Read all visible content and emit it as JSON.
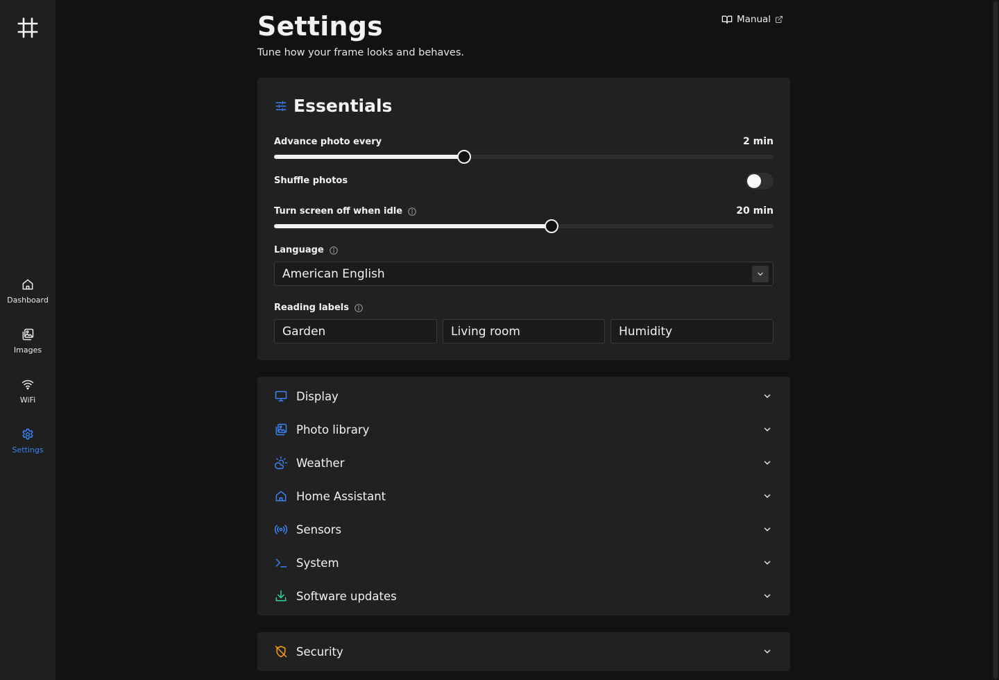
{
  "nav": {
    "items": [
      {
        "id": "dashboard",
        "label": "Dashboard",
        "icon": "home-icon",
        "active": false
      },
      {
        "id": "images",
        "label": "Images",
        "icon": "images-icon",
        "active": false
      },
      {
        "id": "wifi",
        "label": "WiFi",
        "icon": "wifi-icon",
        "active": false
      },
      {
        "id": "settings",
        "label": "Settings",
        "icon": "gear-icon",
        "active": true
      }
    ]
  },
  "header": {
    "title": "Settings",
    "subtitle": "Tune how your frame looks and behaves.",
    "manual_label": "Manual"
  },
  "essentials": {
    "title": "Essentials",
    "advance": {
      "label": "Advance photo every",
      "value": "2 min",
      "fraction": 0.38
    },
    "shuffle": {
      "label": "Shuffle photos",
      "enabled": false
    },
    "idle": {
      "label": "Turn screen off when idle",
      "value": "20 min",
      "fraction": 0.555
    },
    "language": {
      "label": "Language",
      "value": "American English"
    },
    "reading_labels": {
      "label": "Reading labels",
      "values": [
        "Garden",
        "Living room",
        "Humidity"
      ]
    }
  },
  "sections": [
    {
      "label": "Display",
      "icon": "monitor-icon"
    },
    {
      "label": "Photo library",
      "icon": "photo-library-icon"
    },
    {
      "label": "Weather",
      "icon": "weather-icon"
    },
    {
      "label": "Home Assistant",
      "icon": "home-assistant-icon"
    },
    {
      "label": "Sensors",
      "icon": "sensors-icon"
    },
    {
      "label": "System",
      "icon": "terminal-icon"
    },
    {
      "label": "Software updates",
      "icon": "download-icon"
    }
  ],
  "security": {
    "label": "Security",
    "icon": "shield-off-icon"
  },
  "colors": {
    "accent": "#3b82f6",
    "updates": "#34d399",
    "security": "#f59e0b",
    "background": "#121212",
    "card": "#212121",
    "sidebar": "#1f1f1f"
  }
}
